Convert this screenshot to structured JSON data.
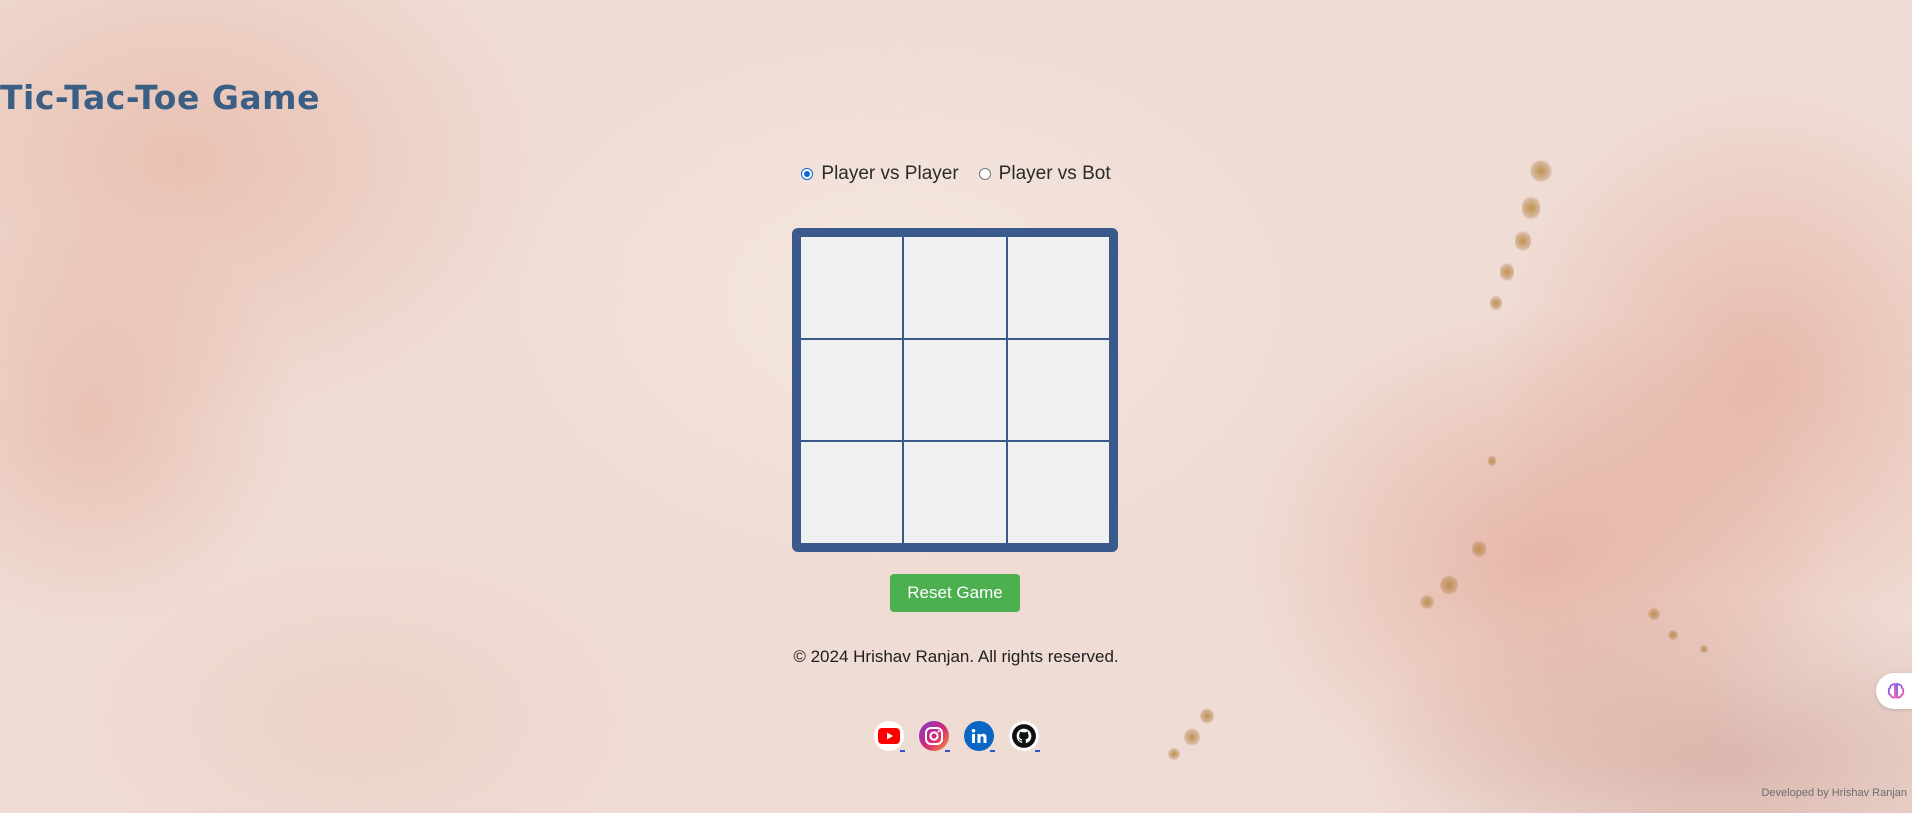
{
  "title": "Tic-Tac-Toe Game",
  "modes": [
    {
      "label": "Player vs Player",
      "checked": true
    },
    {
      "label": "Player vs Bot",
      "checked": false
    }
  ],
  "board": {
    "cells": [
      "",
      "",
      "",
      "",
      "",
      "",
      "",
      "",
      ""
    ]
  },
  "reset_label": "Reset Game",
  "copyright": "© 2024 Hrishav Ranjan. All rights reserved.",
  "socials": [
    {
      "icon": "youtube-icon"
    },
    {
      "icon": "instagram-icon"
    },
    {
      "icon": "linkedin-icon"
    },
    {
      "icon": "github-icon"
    }
  ],
  "developer_credit": "Developed by Hrishav Ranjan",
  "colors": {
    "title": "#3b5f84",
    "board_frame": "#3a5a8c",
    "cell": "#f0f0f0",
    "reset_button": "#4caf50"
  }
}
